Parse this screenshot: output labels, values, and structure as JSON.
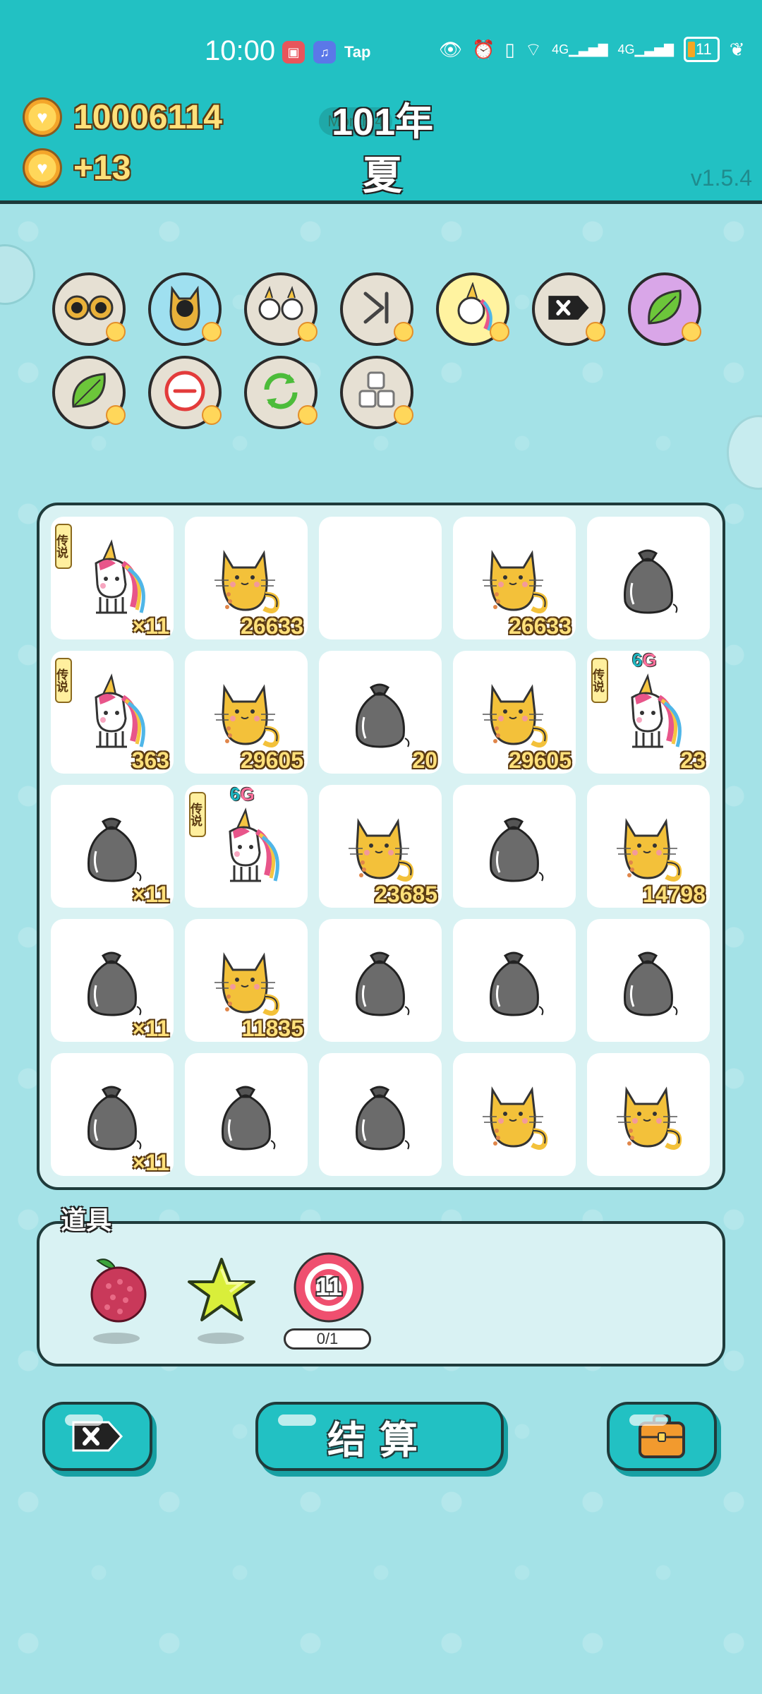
{
  "status_bar": {
    "time": "10:00",
    "apps": [
      "book-icon",
      "music-icon",
      "Tap"
    ],
    "battery": "11"
  },
  "hud": {
    "coins": "10006114",
    "income": "+13",
    "year": "101年",
    "season": "夏",
    "version": "v1.5.4",
    "year_pill": "Month 4"
  },
  "skills_row1": [
    {
      "name": "skill-twin-cats",
      "icon": "cats-icon",
      "bg": "#e6e0d3"
    },
    {
      "name": "skill-cat-transform",
      "icon": "cat-icon",
      "bg": "#9fe0f0"
    },
    {
      "name": "skill-twin-unicorns",
      "icon": "unicorns-icon",
      "bg": "#e6e0d3"
    },
    {
      "name": "skill-skip",
      "icon": "skip-icon",
      "bg": "#e6e0d3"
    },
    {
      "name": "skill-unicorn",
      "icon": "unicorn-icon",
      "bg": "#fff3a0"
    },
    {
      "name": "skill-delete",
      "icon": "delete-icon",
      "bg": "#e6e0d3"
    },
    {
      "name": "skill-leaf-purple",
      "icon": "leaf-icon",
      "bg": "#d9a6e8"
    }
  ],
  "skills_row2": [
    {
      "name": "skill-leaf",
      "icon": "leaf-icon",
      "bg": "#e6e0d3"
    },
    {
      "name": "skill-remove",
      "icon": "minus-circle-icon",
      "bg": "#e6e0d3"
    },
    {
      "name": "skill-refresh",
      "icon": "refresh-icon",
      "bg": "#e6e0d3"
    },
    {
      "name": "skill-blocks",
      "icon": "blocks-icon",
      "bg": "#e6e0d3"
    }
  ],
  "board": [
    [
      {
        "t": "unicorn",
        "n": "×11",
        "tag": "传说"
      },
      {
        "t": "cat",
        "n": "26633"
      },
      {
        "t": "empty",
        "n": ""
      },
      {
        "t": "cat",
        "n": "26633"
      },
      {
        "t": "bag",
        "n": ""
      }
    ],
    [
      {
        "t": "unicorn",
        "n": "363",
        "tag": "传说"
      },
      {
        "t": "cat",
        "n": "29605"
      },
      {
        "t": "bag",
        "n": "20"
      },
      {
        "t": "cat",
        "n": "29605"
      },
      {
        "t": "unicorn",
        "n": "23",
        "tag": "传说",
        "g": "6G"
      }
    ],
    [
      {
        "t": "bag",
        "n": "×11"
      },
      {
        "t": "unicorn",
        "n": "",
        "tag": "传说",
        "g": "6G"
      },
      {
        "t": "cat",
        "n": "23685"
      },
      {
        "t": "bag",
        "n": ""
      },
      {
        "t": "cat",
        "n": "14798"
      }
    ],
    [
      {
        "t": "bag",
        "n": "×11"
      },
      {
        "t": "cat",
        "n": "11835"
      },
      {
        "t": "bag",
        "n": ""
      },
      {
        "t": "bag",
        "n": ""
      },
      {
        "t": "bag",
        "n": ""
      }
    ],
    [
      {
        "t": "bag",
        "n": "×11"
      },
      {
        "t": "bag",
        "n": ""
      },
      {
        "t": "bag",
        "n": ""
      },
      {
        "t": "cat",
        "n": ""
      },
      {
        "t": "cat",
        "n": ""
      }
    ]
  ],
  "items": {
    "title": "道具",
    "list": [
      {
        "name": "item-lychee",
        "icon": "lychee-icon"
      },
      {
        "name": "item-star",
        "icon": "star-icon"
      },
      {
        "name": "item-target",
        "icon": "target-icon",
        "value": "11",
        "counter": "0/1"
      }
    ]
  },
  "buttons": {
    "delete": "delete-icon",
    "settle": "结算",
    "bag": "briefcase-icon"
  },
  "colors": {
    "teal": "#22c1c3",
    "gold": "#ffe07a",
    "outline": "#1f3b3b"
  }
}
